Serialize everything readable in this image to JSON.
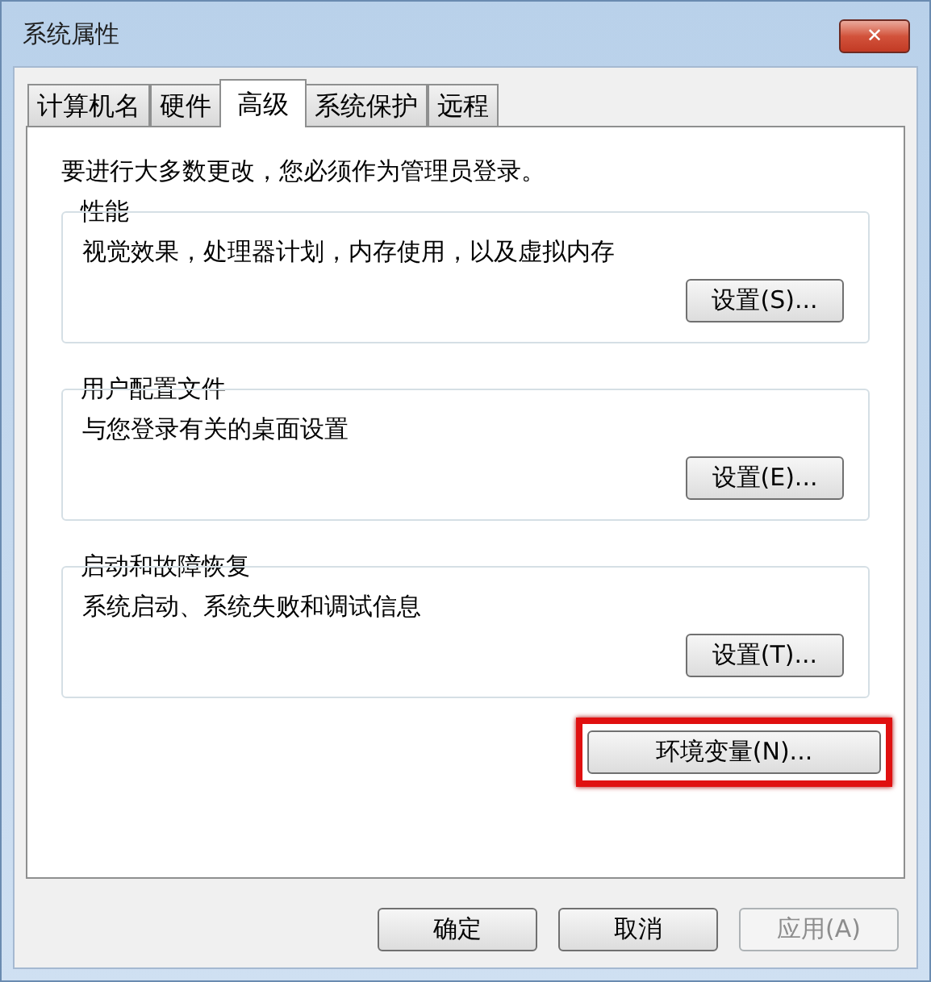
{
  "window": {
    "title": "系统属性",
    "close": "✕"
  },
  "tabs": [
    {
      "label": "计算机名",
      "selected": false
    },
    {
      "label": "硬件",
      "selected": false
    },
    {
      "label": "高级",
      "selected": true
    },
    {
      "label": "系统保护",
      "selected": false
    },
    {
      "label": "远程",
      "selected": false
    }
  ],
  "notice": "要进行大多数更改，您必须作为管理员登录。",
  "groups": [
    {
      "title": "性能",
      "description": "视觉效果，处理器计划，内存使用，以及虚拟内存",
      "button": "设置(S)..."
    },
    {
      "title": "用户配置文件",
      "description": "与您登录有关的桌面设置",
      "button": "设置(E)..."
    },
    {
      "title": "启动和故障恢复",
      "description": "系统启动、系统失败和调试信息",
      "button": "设置(T)..."
    }
  ],
  "env_button": {
    "label": "环境变量(N)...",
    "highlighted": true
  },
  "buttons": [
    {
      "label": "确定",
      "disabled": false
    },
    {
      "label": "取消",
      "disabled": false
    },
    {
      "label": "应用(A)",
      "disabled": true
    }
  ]
}
